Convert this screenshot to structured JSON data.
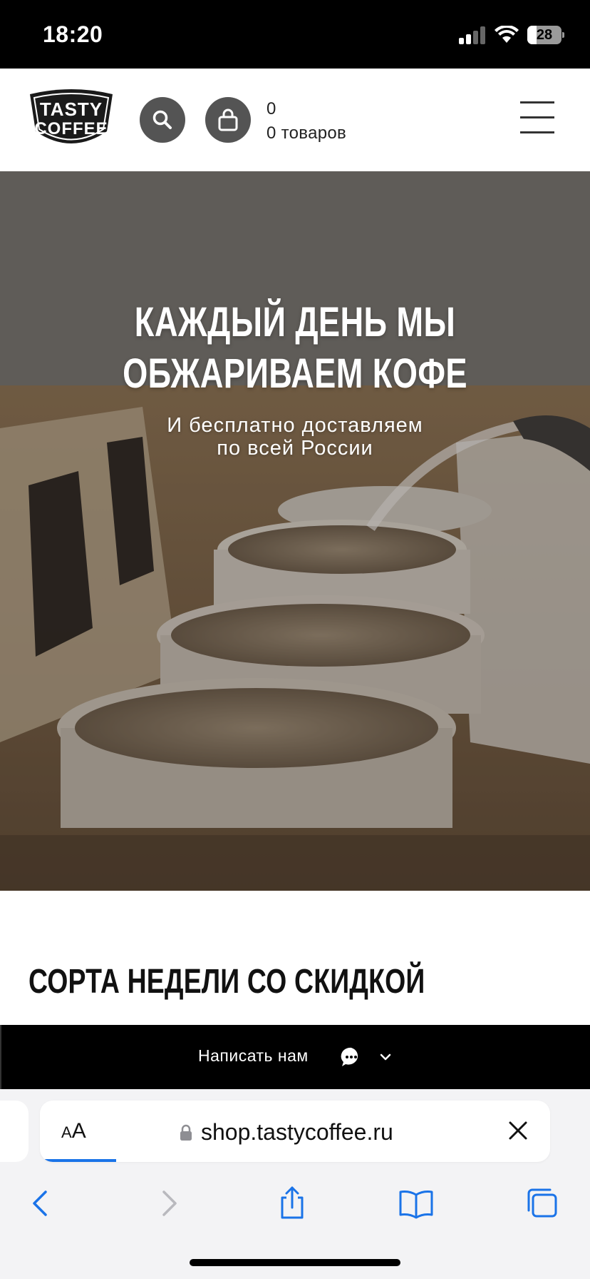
{
  "status_bar": {
    "time": "18:20",
    "battery": "28",
    "battery_level": 0.28,
    "signal_bars_active": 2,
    "icons": [
      "signal-icon",
      "wifi-icon",
      "battery-icon"
    ]
  },
  "header": {
    "logo_text": "TASTY COFFEE",
    "cart_count": "0",
    "cart_items_label": "0 товаров",
    "icons": [
      "search-icon",
      "cart-icon",
      "menu-icon"
    ]
  },
  "hero": {
    "title_line1": "КАЖДЫЙ ДЕНЬ МЫ",
    "title_line2": "ОБЖАРИВАЕМ КОФЕ",
    "subtitle_line1": "И бесплатно доставляем",
    "subtitle_line2": "по всей России"
  },
  "section": {
    "title": "СОРТА НЕДЕЛИ СО СКИДКОЙ"
  },
  "chat": {
    "label": "Написать нам",
    "icons": [
      "chat-bubble-icon",
      "chevron-down-icon"
    ]
  },
  "browser": {
    "aa_small": "A",
    "aa_large": "A",
    "url": "shop.tastycoffee.ru",
    "load_progress": 0.15,
    "icons": [
      "lock-icon",
      "close-icon",
      "back-icon",
      "forward-icon",
      "share-icon",
      "bookmarks-icon",
      "tabs-icon"
    ]
  },
  "colors": {
    "header_icon_bg": "#545454",
    "chat_bar_bg": "#000000",
    "progress": "#1a73e8",
    "safari_accent": "#1a73e8"
  }
}
